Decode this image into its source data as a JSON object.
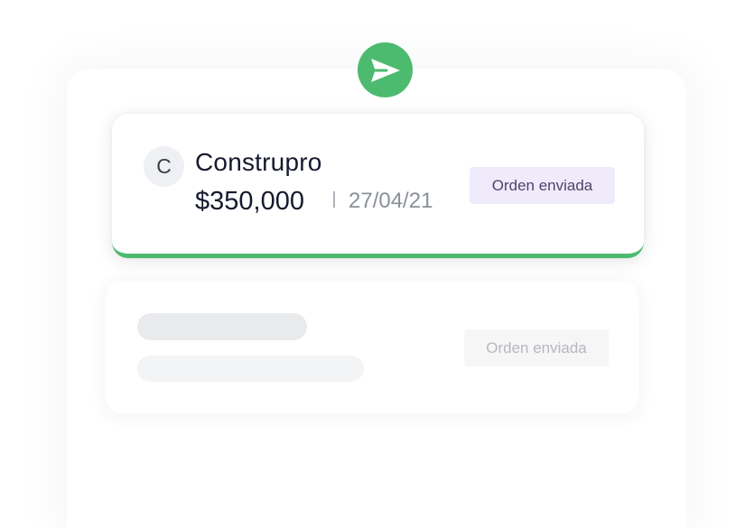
{
  "order_card": {
    "avatar_initial": "C",
    "company": "Construpro",
    "amount": "$350,000",
    "separator": "|",
    "date": "27/04/21",
    "status": "Orden enviada"
  },
  "ghost_card": {
    "status": "Orden enviada"
  },
  "badge": {
    "icon": "send-icon"
  },
  "colors": {
    "accent_green": "#4cbb6f",
    "status_pill_bg": "#efebfb",
    "status_pill_text": "#4d456b",
    "text_primary": "#161a2e",
    "text_muted": "#8b8f99"
  }
}
